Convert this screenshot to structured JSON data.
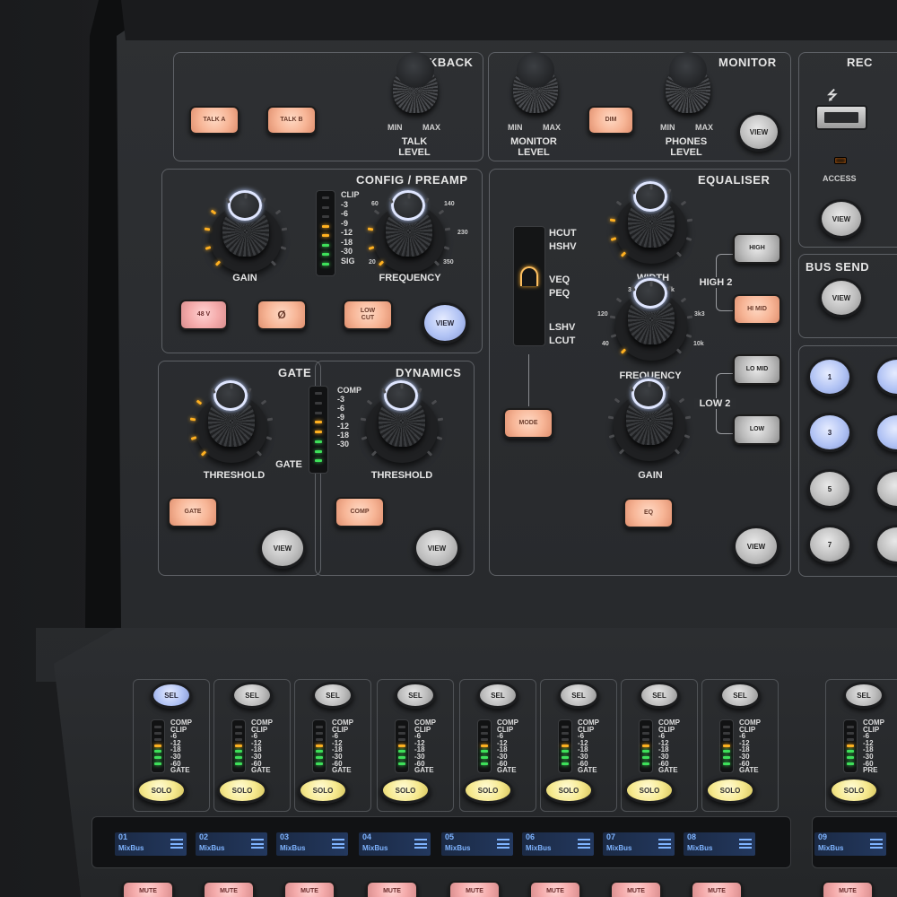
{
  "talkback": {
    "title": "KBACK",
    "talk_a": "TALK A",
    "talk_b": "TALK B",
    "min": "MIN",
    "max": "MAX",
    "level": "TALK\nLEVEL"
  },
  "monitor": {
    "title": "MONITOR",
    "min1": "MIN",
    "max1": "MAX",
    "level1": "MONITOR\nLEVEL",
    "dim": "DIM",
    "min2": "MIN",
    "max2": "MAX",
    "level2": "PHONES\nLEVEL",
    "view": "VIEW"
  },
  "rec": {
    "title": "REC",
    "access": "ACCESS",
    "view": "VIEW"
  },
  "bus_send": {
    "title": "BUS SEND",
    "view": "VIEW",
    "buttons": [
      "1",
      "3",
      "5",
      "7"
    ]
  },
  "config": {
    "title": "CONFIG / PREAMP",
    "gain": "GAIN",
    "frequency": "FREQUENCY",
    "meter": [
      "CLIP",
      "-3",
      "-6",
      "-9",
      "-12",
      "-18",
      "-30",
      "SIG"
    ],
    "freq_scale": {
      "a": "60",
      "b": "140",
      "c": "230",
      "d": "20",
      "e": "350"
    },
    "b48v": "48 V",
    "phase": "Ø",
    "lowcut": "LOW\nCUT",
    "view": "VIEW"
  },
  "gate": {
    "title": "GATE",
    "threshold": "THRESHOLD",
    "gate_label": "GATE",
    "button": "GATE",
    "view": "VIEW"
  },
  "dynamics": {
    "title": "DYNAMICS",
    "meter": [
      "COMP",
      "-3",
      "-6",
      "-9",
      "-12",
      "-18",
      "-30"
    ],
    "threshold": "THRESHOLD",
    "button": "COMP",
    "view": "VIEW"
  },
  "equaliser": {
    "title": "EQUALISER",
    "types": [
      "HCUT",
      "HSHV",
      "VEQ",
      "PEQ",
      "LSHV",
      "LCUT"
    ],
    "mode": "MODE",
    "width": "WIDTH",
    "frequency": "FREQUENCY",
    "freq_scale": {
      "a": "120",
      "b": "3k3",
      "c": "40",
      "d": "10k",
      "e": "3",
      "f": "k"
    },
    "gain": "GAIN",
    "eq": "EQ",
    "high": "HIGH",
    "high2": "HIGH 2",
    "himid": "HI MID",
    "lomid": "LO MID",
    "low2": "LOW 2",
    "low": "LOW",
    "view": "VIEW"
  },
  "strips": [
    {
      "sel": "SEL",
      "meter": [
        "COMP",
        "CLIP",
        "-6",
        "-12",
        "-18",
        "-30",
        "-60",
        "GATE"
      ],
      "solo": "SOLO",
      "num": "01",
      "name": "MixBus",
      "mute": "MUTE"
    },
    {
      "sel": "SEL",
      "meter": [
        "COMP",
        "CLIP",
        "-6",
        "-12",
        "-18",
        "-30",
        "-60",
        "GATE"
      ],
      "solo": "SOLO",
      "num": "02",
      "name": "MixBus",
      "mute": "MUTE"
    },
    {
      "sel": "SEL",
      "meter": [
        "COMP",
        "CLIP",
        "-6",
        "-12",
        "-18",
        "-30",
        "-60",
        "GATE"
      ],
      "solo": "SOLO",
      "num": "03",
      "name": "MixBus",
      "mute": "MUTE"
    },
    {
      "sel": "SEL",
      "meter": [
        "COMP",
        "CLIP",
        "-6",
        "-12",
        "-18",
        "-30",
        "-60",
        "GATE"
      ],
      "solo": "SOLO",
      "num": "04",
      "name": "MixBus",
      "mute": "MUTE"
    },
    {
      "sel": "SEL",
      "meter": [
        "COMP",
        "CLIP",
        "-6",
        "-12",
        "-18",
        "-30",
        "-60",
        "GATE"
      ],
      "solo": "SOLO",
      "num": "05",
      "name": "MixBus",
      "mute": "MUTE"
    },
    {
      "sel": "SEL",
      "meter": [
        "COMP",
        "CLIP",
        "-6",
        "-12",
        "-18",
        "-30",
        "-60",
        "GATE"
      ],
      "solo": "SOLO",
      "num": "06",
      "name": "MixBus",
      "mute": "MUTE"
    },
    {
      "sel": "SEL",
      "meter": [
        "COMP",
        "CLIP",
        "-6",
        "-12",
        "-18",
        "-30",
        "-60",
        "GATE"
      ],
      "solo": "SOLO",
      "num": "07",
      "name": "MixBus",
      "mute": "MUTE"
    },
    {
      "sel": "SEL",
      "meter": [
        "COMP",
        "CLIP",
        "-6",
        "-12",
        "-18",
        "-30",
        "-60",
        "GATE"
      ],
      "solo": "SOLO",
      "num": "08",
      "name": "MixBus",
      "mute": "MUTE"
    },
    {
      "sel": "SEL",
      "meter": [
        "COMP",
        "CLIP",
        "-6",
        "-12",
        "-18",
        "-30",
        "-60",
        "PRE"
      ],
      "solo": "SOLO",
      "num": "09",
      "name": "MixBus",
      "mute": "MUTE"
    }
  ],
  "colors": {
    "orange": "#f7b596",
    "blue": "#b0c2f4",
    "yellow": "#f6e98e",
    "grey": "#bdbdbd",
    "pink": "#f4aaaa",
    "led_green": "#3ee05a",
    "led_amber": "#ffb020",
    "led_red": "#ff3030",
    "lcd_text": "#7fb4ff"
  }
}
